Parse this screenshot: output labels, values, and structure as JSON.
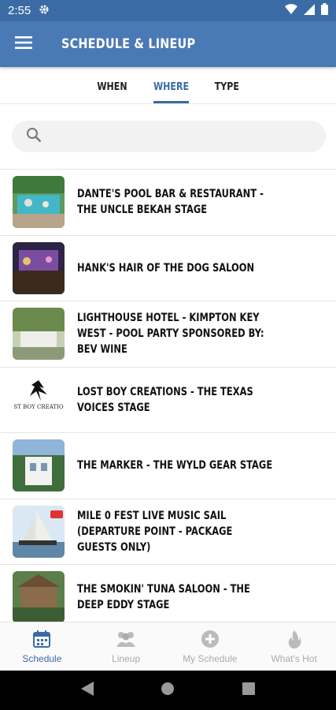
{
  "status_bar": {
    "time": "2:55"
  },
  "app_bar": {
    "title": "SCHEDULE & LINEUP"
  },
  "tabs": [
    {
      "label": "WHEN"
    },
    {
      "label": "WHERE",
      "active": true
    },
    {
      "label": "TYPE"
    }
  ],
  "search": {
    "placeholder": "",
    "value": ""
  },
  "venues": [
    {
      "label": "DANTE'S POOL BAR & RESTAURANT - THE UNCLE BEKAH STAGE"
    },
    {
      "label": "HANK'S HAIR OF THE DOG SALOON"
    },
    {
      "label": "LIGHTHOUSE HOTEL - KIMPTON KEY WEST - POOL PARTY SPONSORED BY: BEV WINE"
    },
    {
      "label": "LOST BOY CREATIONS - THE TEXAS VOICES STAGE",
      "thumb_text": "ST BOY CREATIO"
    },
    {
      "label": "THE MARKER - THE WYLD GEAR STAGE"
    },
    {
      "label": "MILE 0 FEST LIVE MUSIC SAIL (DEPARTURE POINT - PACKAGE GUESTS ONLY)"
    },
    {
      "label": "THE SMOKIN' TUNA SALOON - THE DEEP EDDY STAGE"
    }
  ],
  "bottom_nav": [
    {
      "label": "Schedule",
      "icon": "calendar-icon",
      "active": true
    },
    {
      "label": "Lineup",
      "icon": "group-icon"
    },
    {
      "label": "My Schedule",
      "icon": "plus-circle-icon"
    },
    {
      "label": "What's Hot",
      "icon": "flame-icon"
    }
  ],
  "colors": {
    "primary": "#4a7ab5",
    "status_bar": "#3b6ba5",
    "accent": "#3b6ba5"
  }
}
